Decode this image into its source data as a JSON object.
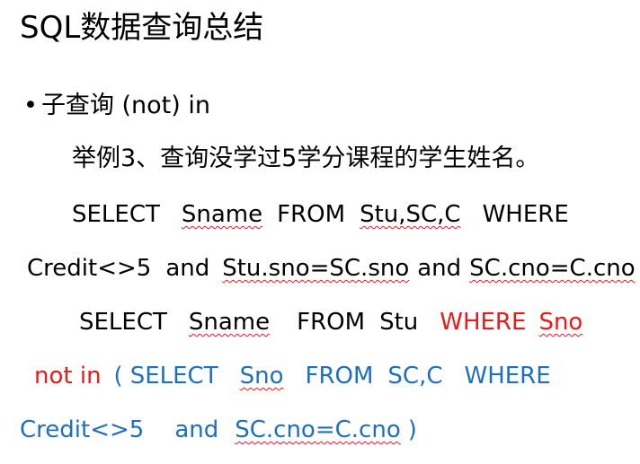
{
  "slide": {
    "title": "SQL数据查询总结",
    "bullet": {
      "dot": "•",
      "text": "子查询 (not) in"
    },
    "example": "举例3、查询没学过5学分课程的学生姓名。",
    "query1": {
      "line1": {
        "select": "SELECT",
        "sname": "Sname",
        "from": "FROM",
        "tables": "Stu,SC,C",
        "where": "WHERE"
      },
      "line2": {
        "credit": "Credit<>5",
        "and1": "and",
        "join1": "Stu.sno=SC.sno",
        "and2": "and",
        "join2": "SC.cno=C.cno"
      }
    },
    "query2": {
      "line3": {
        "select": "SELECT",
        "sname": "Sname",
        "from": "FROM",
        "table": "Stu",
        "where": "WHERE",
        "sno": "Sno"
      },
      "line4": {
        "notin": "not in",
        "open": "(",
        "select": "SELECT",
        "sno": "Sno",
        "from": "FROM",
        "tables": "SC,C",
        "where": "WHERE"
      },
      "line5": {
        "credit": "Credit<>5",
        "and": "and",
        "join": "SC.cno=C.cno",
        "close": ")"
      }
    }
  }
}
